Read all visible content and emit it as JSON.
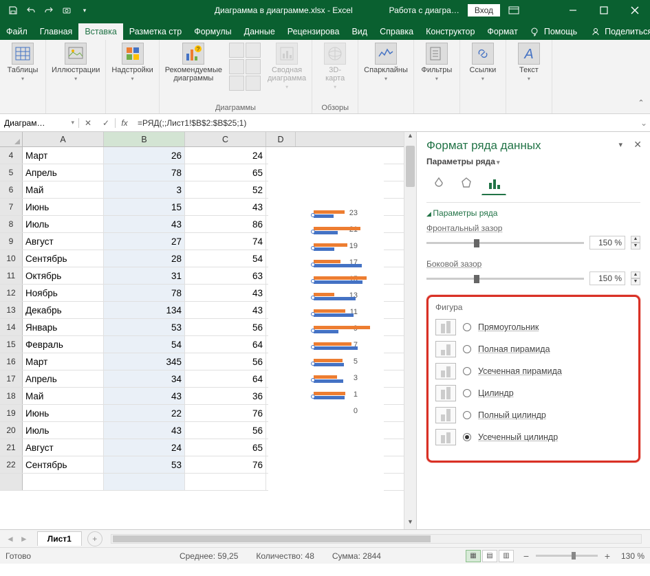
{
  "titlebar": {
    "doc_title": "Диаграмма в диаграмме.xlsx  -  Excel",
    "context_title": "Работа с диагра…",
    "login": "Вход"
  },
  "tabs": {
    "file": "Файл",
    "home": "Главная",
    "insert": "Вставка",
    "layout": "Разметка стр",
    "formulas": "Формулы",
    "data": "Данные",
    "review": "Рецензирова",
    "view": "Вид",
    "help": "Справка",
    "design": "Конструктор",
    "format": "Формат",
    "assist": "Помощь",
    "share": "Поделиться"
  },
  "ribbon": {
    "tables": "Таблицы",
    "illustrations": "Иллюстрации",
    "addins": "Надстройки",
    "recommended": "Рекомендуемые\nдиаграммы",
    "charts_group": "Диаграммы",
    "pivot_chart": "Сводная\nдиаграмма",
    "tours_group": "Обзоры",
    "map3d": "3D-\nкарта",
    "sparklines": "Спарклайны",
    "filters": "Фильтры",
    "links": "Ссылки",
    "text": "Текст"
  },
  "namebox": "Диаграм…",
  "formula": "=РЯД(;;Лист1!$B$2:$B$25;1)",
  "columns": [
    "A",
    "B",
    "C",
    "D"
  ],
  "rows": [
    {
      "n": 4,
      "a": "Март",
      "b": 26,
      "c": 24
    },
    {
      "n": 5,
      "a": "Апрель",
      "b": 78,
      "c": 65
    },
    {
      "n": 6,
      "a": "Май",
      "b": 3,
      "c": 52
    },
    {
      "n": 7,
      "a": "Июнь",
      "b": 15,
      "c": 43
    },
    {
      "n": 8,
      "a": "Июль",
      "b": 43,
      "c": 86
    },
    {
      "n": 9,
      "a": "Август",
      "b": 27,
      "c": 74
    },
    {
      "n": 10,
      "a": "Сентябрь",
      "b": 28,
      "c": 54
    },
    {
      "n": 11,
      "a": "Октябрь",
      "b": 31,
      "c": 63
    },
    {
      "n": 12,
      "a": "Ноябрь",
      "b": 78,
      "c": 43
    },
    {
      "n": 13,
      "a": "Декабрь",
      "b": 134,
      "c": 43
    },
    {
      "n": 14,
      "a": "Январь",
      "b": 53,
      "c": 56
    },
    {
      "n": 15,
      "a": "Февраль",
      "b": 54,
      "c": 64
    },
    {
      "n": 16,
      "a": "Март",
      "b": 345,
      "c": 56
    },
    {
      "n": 17,
      "a": "Апрель",
      "b": 34,
      "c": 64
    },
    {
      "n": 18,
      "a": "Май",
      "b": 43,
      "c": 36
    },
    {
      "n": 19,
      "a": "Июнь",
      "b": 22,
      "c": 76
    },
    {
      "n": 20,
      "a": "Июль",
      "b": 43,
      "c": 56
    },
    {
      "n": 21,
      "a": "Август",
      "b": 24,
      "c": 65
    },
    {
      "n": 22,
      "a": "Сентябрь",
      "b": 53,
      "c": 76
    }
  ],
  "chart": {
    "axis_labels": [
      "23",
      "21",
      "19",
      "17",
      "15",
      "13",
      "11",
      "9",
      "7",
      "5",
      "3",
      "1",
      "0"
    ]
  },
  "format_pane": {
    "title": "Формат ряда данных",
    "subtitle": "Параметры ряда",
    "section": "Параметры ряда",
    "gap_depth_label": "Фронтальный зазор",
    "gap_depth_value": "150 %",
    "gap_width_label": "Боковой зазор",
    "gap_width_value": "150 %",
    "shape_title": "Фигура",
    "shapes": [
      {
        "label": "Прямоугольник",
        "checked": false
      },
      {
        "label": "Полная пирамида",
        "checked": false
      },
      {
        "label": "Усеченная пирамида",
        "checked": false
      },
      {
        "label": "Цилиндр",
        "checked": false
      },
      {
        "label": "Полный цилиндр",
        "checked": false
      },
      {
        "label": "Усеченный цилиндр",
        "checked": true
      }
    ]
  },
  "sheet_tabs": {
    "tab1": "Лист1"
  },
  "statusbar": {
    "ready": "Готово",
    "avg_label": "Среднее:",
    "avg_val": "59,25",
    "count_label": "Количество:",
    "count_val": "48",
    "sum_label": "Сумма:",
    "sum_val": "2844",
    "zoom": "130 %"
  }
}
